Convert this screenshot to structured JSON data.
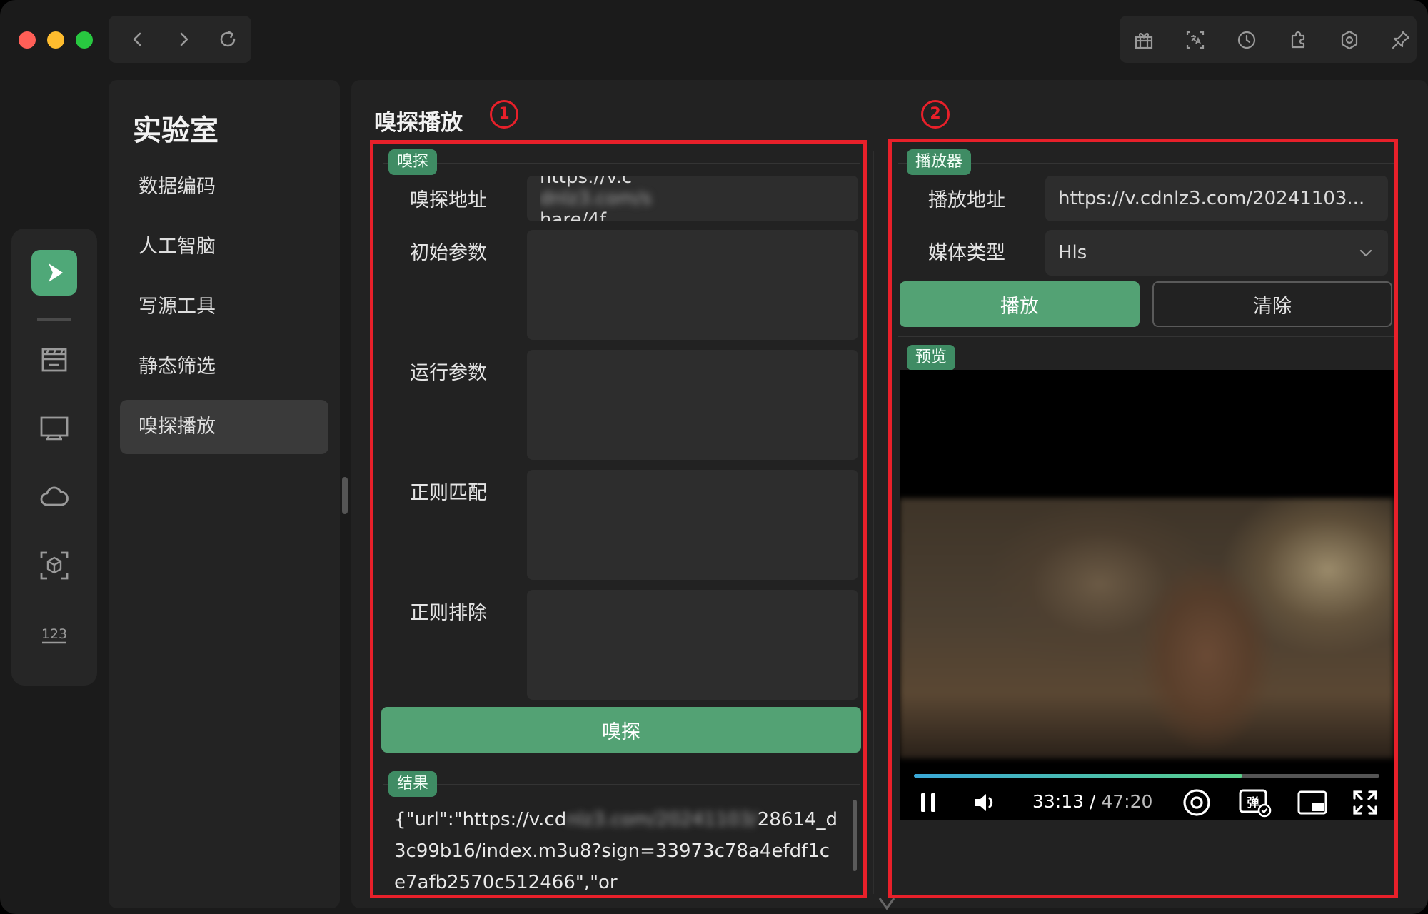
{
  "toolbar": {
    "back_icon": "chevron-left-icon",
    "forward_icon": "chevron-right-icon",
    "reload_icon": "reload-icon",
    "tools": [
      "gift-icon",
      "translate-icon",
      "history-icon",
      "plugin-icon",
      "settings-icon",
      "pin-icon"
    ]
  },
  "rail": {
    "logo": "app-logo-icon",
    "icons": [
      "film-icon",
      "tv-icon",
      "cloud-icon",
      "cube-scan-icon",
      "numbers-icon"
    ]
  },
  "menu": {
    "title": "实验室",
    "items": [
      {
        "label": "数据编码"
      },
      {
        "label": "人工智脑"
      },
      {
        "label": "写源工具"
      },
      {
        "label": "静态筛选"
      },
      {
        "label": "嗅探播放"
      }
    ]
  },
  "main": {
    "title": "嗅探播放",
    "annotation_1": "1",
    "annotation_2": "2"
  },
  "sniff": {
    "tag": "嗅探",
    "address_label": "嗅探地址",
    "address_value_a": "https://v.c",
    "address_value_blur": "dnlz3.com/s",
    "address_value_b": "hare/4f...",
    "init_params_label": "初始参数",
    "run_params_label": "运行参数",
    "regex_match_label": "正则匹配",
    "regex_exclude_label": "正则排除",
    "sniff_button": "嗅探"
  },
  "result": {
    "tag": "结果",
    "text_a": "{\"url\":\"https://v.cd",
    "text_blur": "nlz3.com/20241103/",
    "text_b": "28614_d3c99b16/index.m3u8?sign=33973c78a4efdf1ce7afb2570c512466\",\"or"
  },
  "player": {
    "tag": "播放器",
    "address_label": "播放地址",
    "address_value": "https://v.cdnlz3.com/20241103...",
    "media_type_label": "媒体类型",
    "media_type_value": "Hls",
    "play_button": "播放",
    "clear_button": "清除"
  },
  "preview": {
    "tag": "预览",
    "current_time": "33:13",
    "separator": " / ",
    "total_time": "47:20",
    "progress": 0.705,
    "controls": [
      "pause-icon",
      "volume-icon",
      "screenshot-icon",
      "danmaku-icon",
      "pip-icon",
      "fullscreen-icon"
    ]
  },
  "colors": {
    "accent": "#53a274",
    "annotation": "#e8202a",
    "background": "#1b1b1b"
  }
}
